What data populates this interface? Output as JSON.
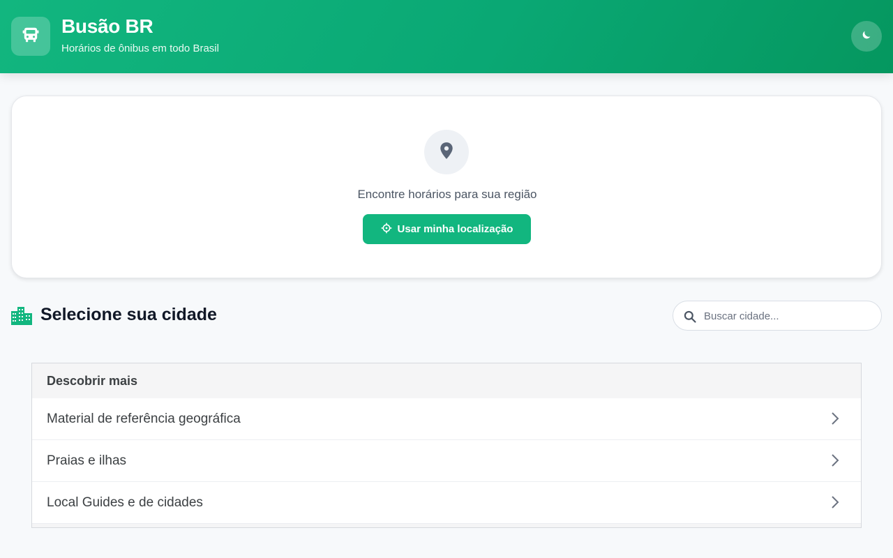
{
  "header": {
    "title": "Busão BR",
    "subtitle": "Horários de ônibus em todo Brasil",
    "logo_icon": "bus-icon",
    "theme_toggle_icon": "moon-icon"
  },
  "location_card": {
    "icon": "map-pin-icon",
    "text": "Encontre horários para sua região",
    "button_label": "Usar minha localização",
    "button_icon": "crosshair-icon"
  },
  "city_section": {
    "icon": "city-icon",
    "title": "Selecione sua cidade",
    "search": {
      "placeholder": "Buscar cidade...",
      "value": ""
    }
  },
  "discover": {
    "title": "Descobrir mais",
    "items": [
      {
        "label": "Material de referência geográfica"
      },
      {
        "label": "Praias e ilhas"
      },
      {
        "label": "Local Guides e de cidades"
      }
    ]
  },
  "colors": {
    "brand": "#12b67f",
    "brand_dark": "#05975f",
    "background": "#f7f9fb"
  }
}
